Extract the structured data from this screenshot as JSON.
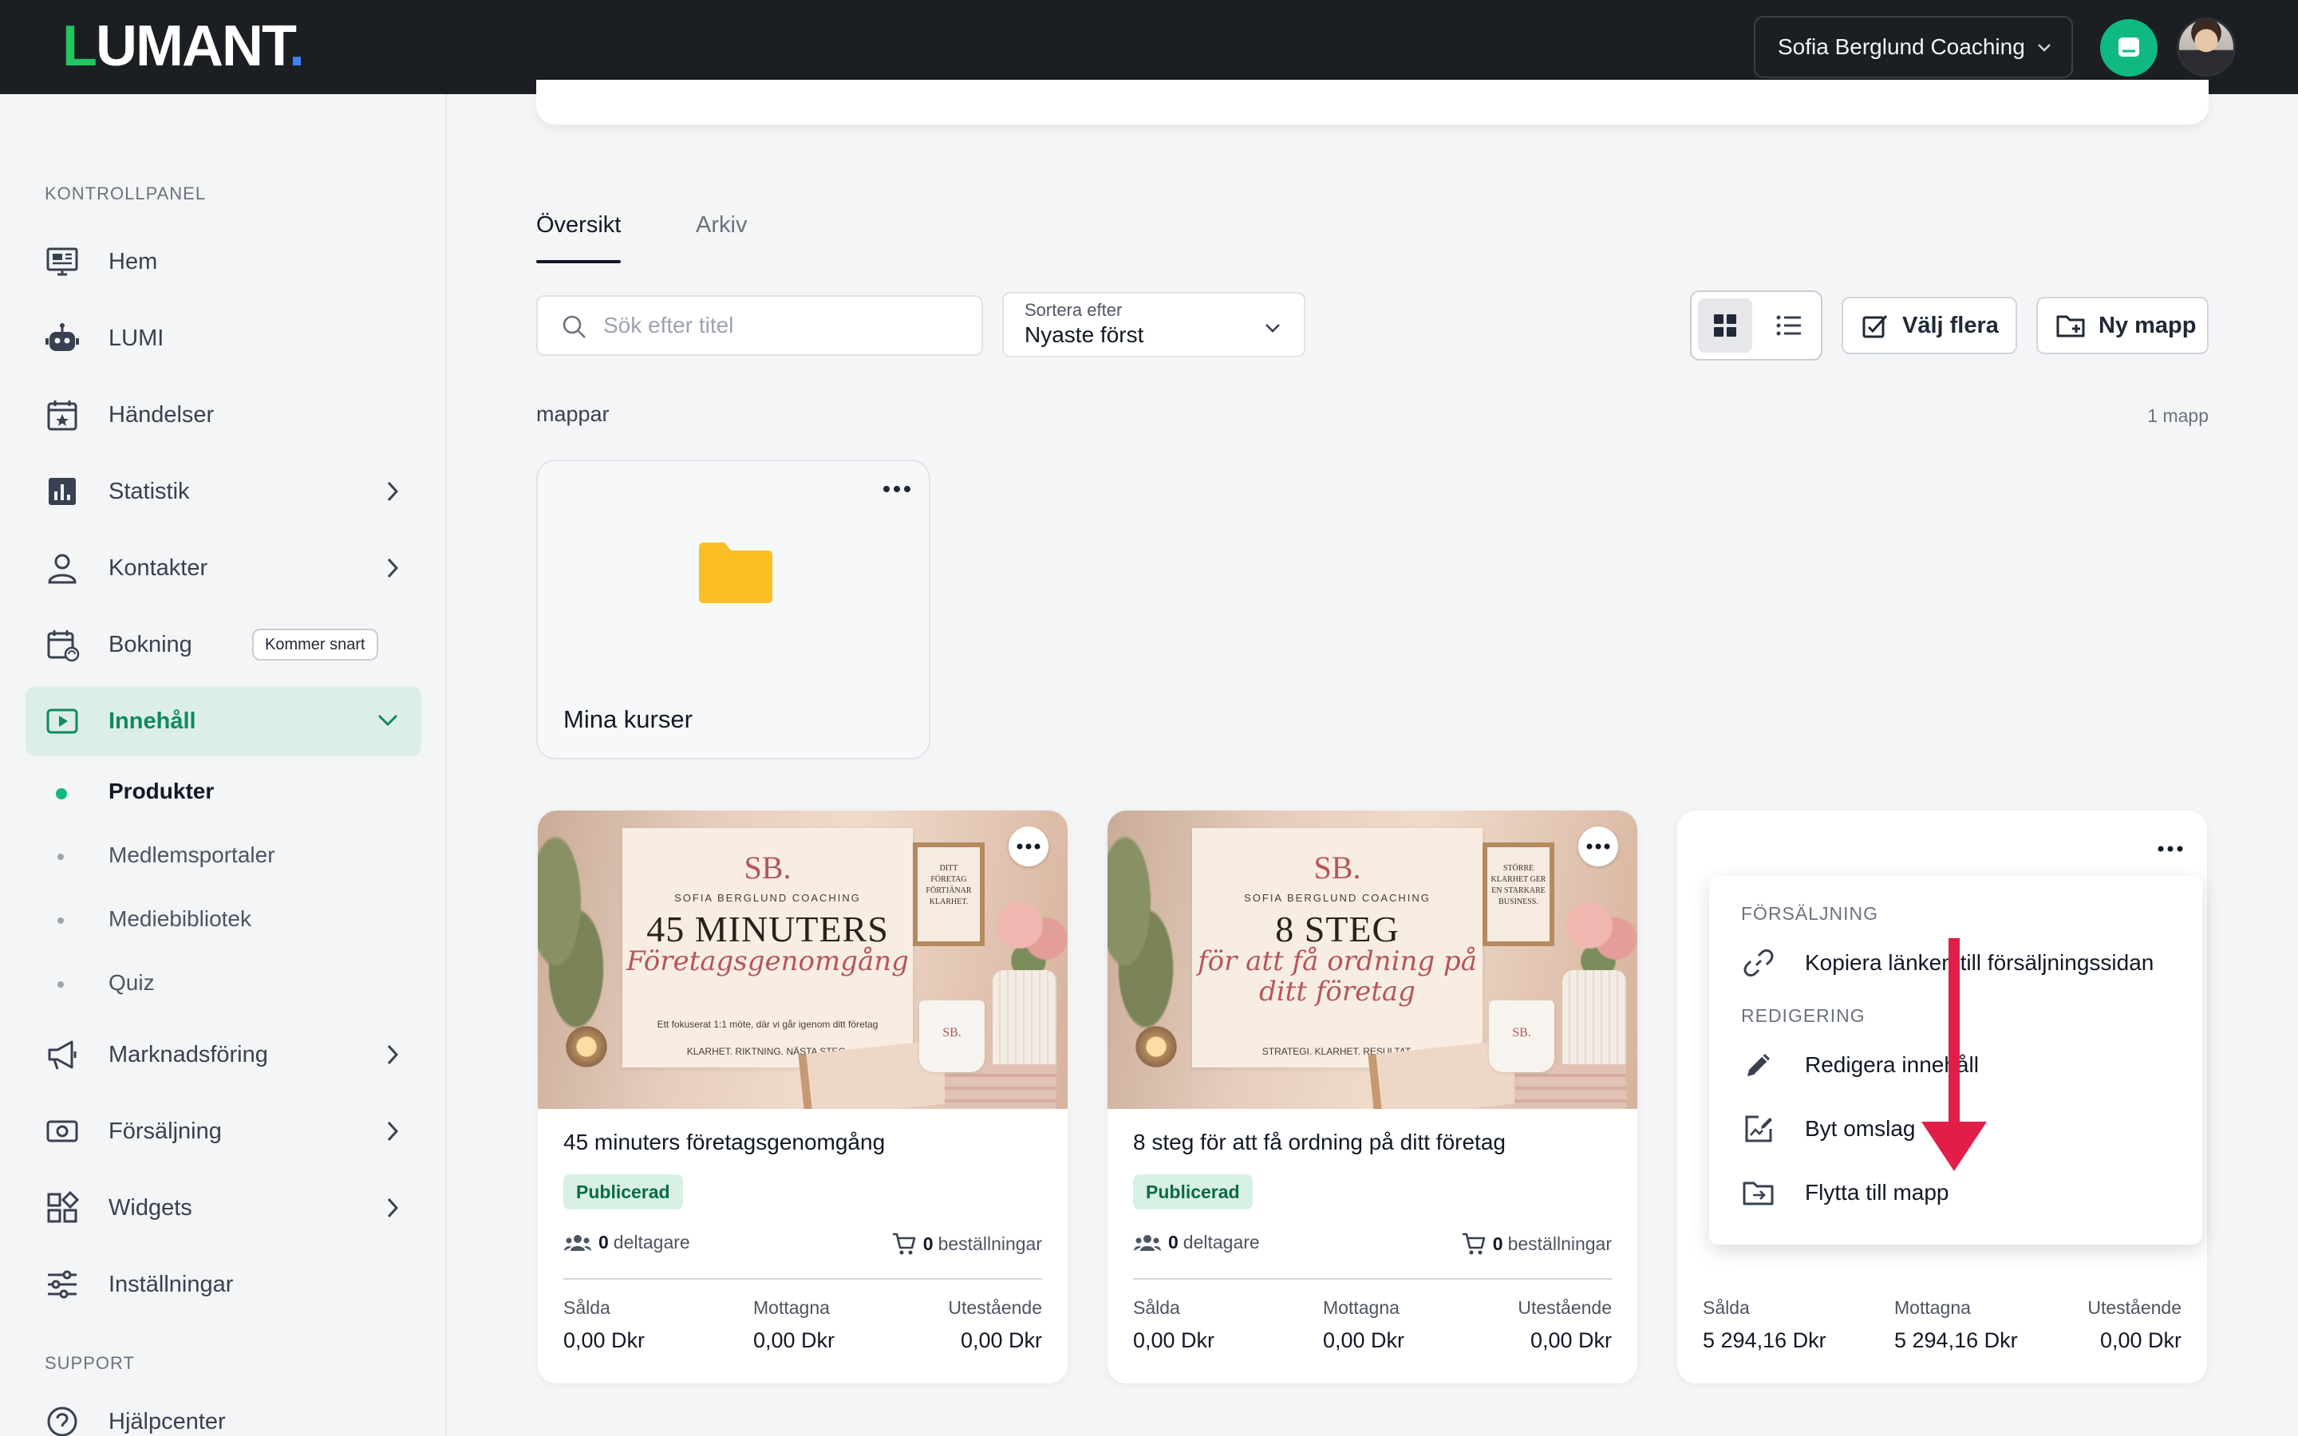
{
  "topbar": {
    "logo": {
      "l": "L",
      "rest": "UMANT",
      "dot": "."
    },
    "account": "Sofia Berglund Coaching"
  },
  "sidebar": {
    "section_main": "KONTROLLPANEL",
    "section_support": "SUPPORT",
    "items": [
      {
        "label": "Hem",
        "icon": "monitor-icon"
      },
      {
        "label": "LUMI",
        "icon": "robot-icon"
      },
      {
        "label": "Händelser",
        "icon": "calendar-star-icon"
      },
      {
        "label": "Statistik",
        "icon": "bar-chart-icon"
      },
      {
        "label": "Kontakter",
        "icon": "user-icon"
      },
      {
        "label": "Bokning",
        "icon": "calendar-sync-icon",
        "badge": "Kommer snart"
      },
      {
        "label": "Innehåll",
        "icon": "play-square-icon"
      },
      {
        "label": "Marknadsföring",
        "icon": "megaphone-icon"
      },
      {
        "label": "Försäljning",
        "icon": "cash-icon"
      },
      {
        "label": "Widgets",
        "icon": "widgets-icon"
      },
      {
        "label": "Inställningar",
        "icon": "sliders-icon"
      },
      {
        "label": "Hjälpcenter",
        "icon": "help-icon"
      }
    ],
    "subitems": [
      "Produkter",
      "Medlemsportaler",
      "Mediebibliotek",
      "Quiz"
    ]
  },
  "main": {
    "tabs": [
      "Översikt",
      "Arkiv"
    ],
    "search_placeholder": "Sök efter titel",
    "sort": {
      "caption": "Sortera efter",
      "value": "Nyaste först"
    },
    "select_multiple": "Välj flera",
    "new_folder": "Ny mapp",
    "folders_label": "mappar",
    "folders_count": "1 mapp",
    "folder": {
      "name": "Mina kurser"
    }
  },
  "products": [
    {
      "title": "45 minuters företagsgenomgång",
      "status": "Publicerad",
      "participants": "0",
      "participants_label": "deltagare",
      "orders": "0",
      "orders_label": "beställningar",
      "sold_label": "Sålda",
      "sold": "0,00 Dkr",
      "received_label": "Mottagna",
      "received": "0,00 Dkr",
      "outstanding_label": "Utestående",
      "outstanding": "0,00 Dkr",
      "cover": {
        "monogram": "SB.",
        "brand": "SOFIA BERGLUND COACHING",
        "headline": "45 MINUTERS",
        "script": "Företagsgenomgång",
        "small": "Ett fokuserat 1:1 möte, där vi går igenom ditt företag",
        "small2": "KLARHET. RIKTNING. NÄSTA STEG.",
        "frame": "DITT FÖRETAG FÖRTJÄNAR KLARHET."
      }
    },
    {
      "title": "8 steg för att få ordning på ditt företag",
      "status": "Publicerad",
      "participants": "0",
      "participants_label": "deltagare",
      "orders": "0",
      "orders_label": "beställningar",
      "sold_label": "Sålda",
      "sold": "0,00 Dkr",
      "received_label": "Mottagna",
      "received": "0,00 Dkr",
      "outstanding_label": "Utestående",
      "outstanding": "0,00 Dkr",
      "cover": {
        "monogram": "SB.",
        "brand": "SOFIA BERGLUND COACHING",
        "headline": "8 STEG",
        "script": "för att få ordning på ditt företag",
        "small": "",
        "small2": "STRATEGI. KLARHET. RESULTAT.",
        "frame": "STÖRRE KLARHET GER EN STARKARE BUSINESS."
      }
    },
    {
      "sold_label": "Sålda",
      "sold": "5 294,16 Dkr",
      "received_label": "Mottagna",
      "received": "5 294,16 Dkr",
      "outstanding_label": "Utestående",
      "outstanding": "0,00 Dkr"
    }
  ],
  "context_menu": {
    "group_sales": "FÖRSÄLJNING",
    "copy_link": "Kopiera länken till försäljningssidan",
    "group_edit": "REDIGERING",
    "edit_content": "Redigera innehåll",
    "change_cover": "Byt omslag",
    "move_to_folder": "Flytta till mapp"
  },
  "colors": {
    "accent": "#10b981",
    "topbar": "#1b1f24",
    "active_nav_bg": "#dcefe6",
    "folder": "#fbbf24",
    "annotation_arrow": "#e11d48"
  }
}
